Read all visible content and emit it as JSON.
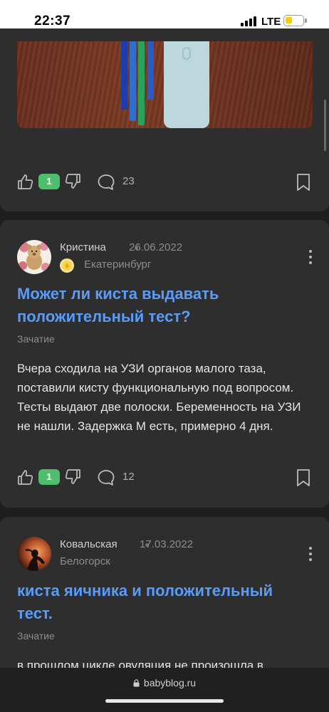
{
  "status_bar": {
    "time": "22:37",
    "network": "LTE",
    "battery_level": 0.3
  },
  "posts": [
    {
      "likes": "1",
      "comments": "23"
    },
    {
      "author": "Кристина",
      "date": "26.06.2022",
      "city": "Екатеринбург",
      "title": "Может ли киста выдавать положительный тест?",
      "category": "Зачатие",
      "text": "Вчера сходила на УЗИ органов малого таза, поставили кисту функциональную под вопросом. Тесты выдают две полоски. Беременность на УЗИ не нашли. Задержка М есть, примерно 4 дня.",
      "likes": "1",
      "comments": "12"
    },
    {
      "author": "Ковальская",
      "date": "17.03.2022",
      "city": "Белогорск",
      "title": "киста яичника и положительный тест.",
      "category": "Зачатие",
      "text": "в прошлом цикле овуляция не произошла в"
    }
  ],
  "browser": {
    "url": "babyblog.ru"
  },
  "colors": {
    "accent_title": "#5a9cf5",
    "like_pill": "#4fbf6e",
    "card_bg": "#2e2e2e",
    "page_bg": "#1e1e1e"
  }
}
